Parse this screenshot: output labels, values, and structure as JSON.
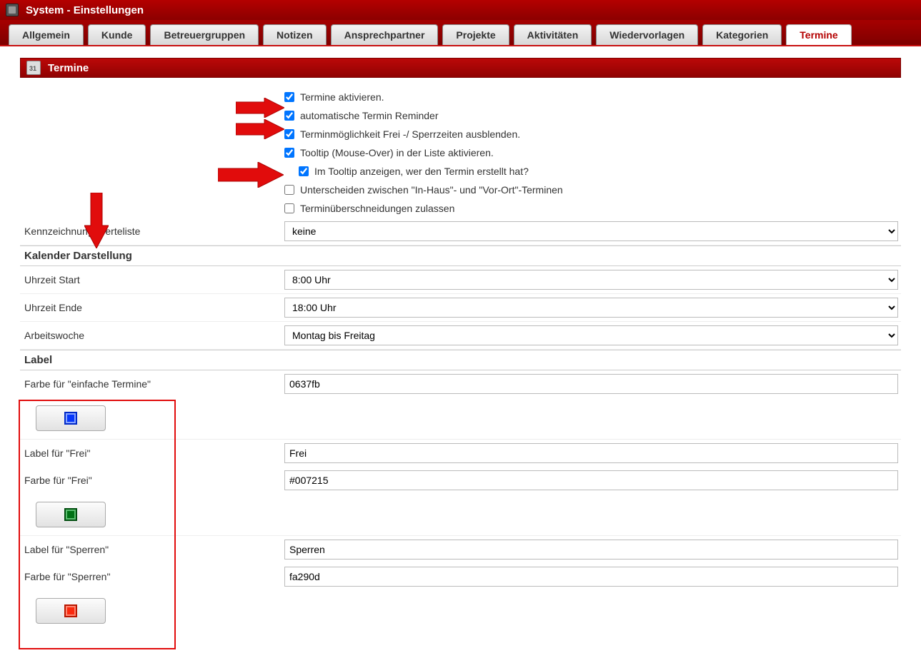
{
  "titlebar": {
    "title": "System - Einstellungen"
  },
  "tabs": [
    {
      "label": "Allgemein",
      "active": false
    },
    {
      "label": "Kunde",
      "active": false
    },
    {
      "label": "Betreuergruppen",
      "active": false
    },
    {
      "label": "Notizen",
      "active": false
    },
    {
      "label": "Ansprechpartner",
      "active": false
    },
    {
      "label": "Projekte",
      "active": false
    },
    {
      "label": "Aktivitäten",
      "active": false
    },
    {
      "label": "Wiedervorlagen",
      "active": false
    },
    {
      "label": "Kategorien",
      "active": false
    },
    {
      "label": "Termine",
      "active": true
    }
  ],
  "section_banner": "Termine",
  "checkboxes": {
    "activate": {
      "label": "Termine aktivieren.",
      "checked": true
    },
    "reminder": {
      "label": "automatische Termin Reminder",
      "checked": true
    },
    "hide_free_block": {
      "label": "Terminmöglichkeit Frei -/ Sperrzeiten ausblenden.",
      "checked": true
    },
    "tooltip": {
      "label": "Tooltip (Mouse-Over) in der Liste aktivieren.",
      "checked": true
    },
    "tooltip_creator": {
      "label": "Im Tooltip anzeigen, wer den Termin erstellt hat?",
      "checked": true
    },
    "inout": {
      "label": "Unterscheiden zwischen \"In-Haus\"- und \"Vor-Ort\"-Terminen",
      "checked": false
    },
    "overlap": {
      "label": "Terminüberschneidungen zulassen",
      "checked": false
    }
  },
  "rows": {
    "valuelist_label": "Kennzeichnung Werteliste",
    "valuelist_value": "keine",
    "calendar_heading": "Kalender Darstellung",
    "time_start_label": "Uhrzeit Start",
    "time_start_value": "8:00 Uhr",
    "time_end_label": "Uhrzeit Ende",
    "time_end_value": "18:00 Uhr",
    "workweek_label": "Arbeitswoche",
    "workweek_value": "Montag bis Freitag",
    "label_heading": "Label",
    "color_simple_label": "Farbe für \"einfache Termine\"",
    "color_simple_value": "0637fb",
    "label_free_label": "Label für \"Frei\"",
    "label_free_value": "Frei",
    "color_free_label": "Farbe für \"Frei\"",
    "color_free_value": "#007215",
    "label_block_label": "Label für \"Sperren\"",
    "label_block_value": "Sperren",
    "color_block_label": "Farbe für \"Sperren\"",
    "color_block_value": "fa290d"
  }
}
